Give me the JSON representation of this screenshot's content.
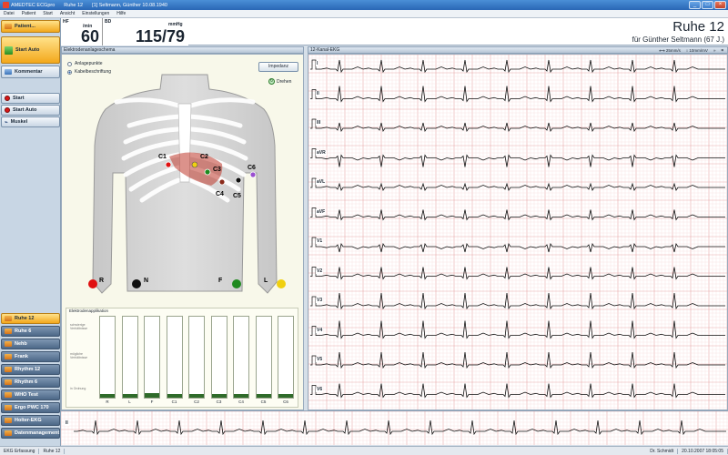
{
  "window": {
    "app": "AMEDTEC ECGpro",
    "tab": "Ruhe 12",
    "patient": "[1] Seltmann, Günther 10.08.1940"
  },
  "menu": [
    "Datei",
    "Patient",
    "Start",
    "Ansicht",
    "Einstellungen",
    "Hilfe"
  ],
  "sidebar": {
    "patient": "Patient...",
    "start_auto_big": "Start Auto",
    "kommentar": "Kommentar",
    "start": "Start",
    "start_auto": "Start Auto",
    "muskel": "Muskel",
    "programs": [
      "Ruhe 12",
      "Ruhe 6",
      "Nehb",
      "Frank",
      "Rhythm 12",
      "Rhythm 6",
      "WHO Test",
      "Ergo PWC 170",
      "Holter-EKG",
      "Datenmanagement"
    ]
  },
  "vitals": {
    "hf_label": "HF",
    "hf_unit": "/min",
    "hf_value": "60",
    "bd_label": "BD",
    "bd_unit": "mmHg",
    "bd_value": "115/79"
  },
  "header": {
    "title": "Ruhe 12",
    "subtitle": "für Günther Seltmann (67 J.)"
  },
  "electrode_panel": {
    "title": "Elektrodenanlageschema",
    "options": [
      "Anlagepunkte",
      "Kabelbeschriftung"
    ],
    "impedanz": "Impedanz",
    "drehen": "Drehen",
    "electrodes": [
      "R",
      "N",
      "F",
      "L",
      "C1",
      "C2",
      "C3",
      "C4",
      "C5",
      "C6"
    ],
    "bar_title": "Elektrodenapplikation",
    "bar_axis": [
      "schwierige Verhältnisse",
      "mögliche Verhältnisse",
      "in Ordnung"
    ],
    "bars": [
      {
        "label": "R",
        "fill": 0.04
      },
      {
        "label": "L",
        "fill": 0.04
      },
      {
        "label": "F",
        "fill": 0.06
      },
      {
        "label": "C1",
        "fill": 0.04
      },
      {
        "label": "C2",
        "fill": 0.04
      },
      {
        "label": "C3",
        "fill": 0.04
      },
      {
        "label": "C4",
        "fill": 0.04
      },
      {
        "label": "C5",
        "fill": 0.04
      },
      {
        "label": "C6",
        "fill": 0.04
      }
    ]
  },
  "ekg_panel": {
    "title": "12-Kanal-EKG",
    "speed": "25mm/s",
    "gain": "10mm/mV",
    "leads": [
      "I",
      "II",
      "III",
      "aVR",
      "aVL",
      "aVF",
      "V1",
      "V2",
      "V3",
      "V4",
      "V5",
      "V6"
    ]
  },
  "rhythm": {
    "lead": "II"
  },
  "status": {
    "left1": "EKG Erfassung",
    "left2": "Ruhe 12",
    "user": "Dr. Schmidt",
    "datetime": "20.10.2007 18:05:05"
  },
  "colors": {
    "accent": "#f3a81c",
    "ecg": "#1a1a1a",
    "grid": "#f0c8c8"
  }
}
